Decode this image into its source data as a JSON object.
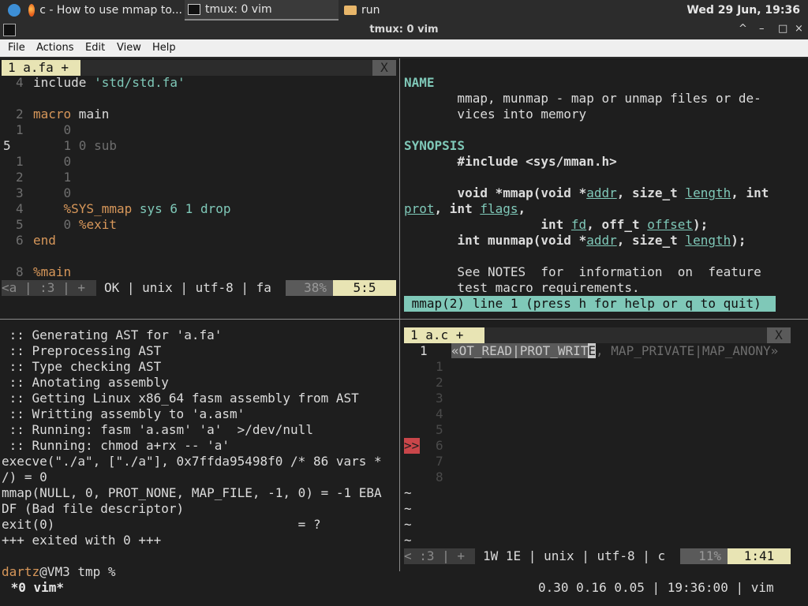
{
  "taskbar": {
    "tabs": [
      {
        "label": "c - How to use mmap to..."
      },
      {
        "label": "tmux: 0 vim"
      },
      {
        "label": "run"
      }
    ],
    "clock": "Wed 29 Jun, 19:36"
  },
  "window": {
    "title": "tmux: 0 vim",
    "controls": [
      "^",
      "–",
      "□",
      "×"
    ]
  },
  "menu": [
    "File",
    "Actions",
    "Edit",
    "View",
    "Help"
  ],
  "left_top": {
    "tab": "1 a.fa +",
    "close": "X",
    "lines": [
      {
        "num": "4",
        "text": "include 'std/std.fa'"
      },
      {
        "num": "",
        "text": ""
      },
      {
        "num": "2",
        "text": "macro main"
      },
      {
        "num": "1",
        "text": "    0"
      },
      {
        "num": "5",
        "text": "    1 0 sub"
      },
      {
        "num": "1",
        "text": "    0"
      },
      {
        "num": "2",
        "text": "    1"
      },
      {
        "num": "3",
        "text": "    0"
      },
      {
        "num": "4",
        "text": "    %SYS_mmap sys 6 1 drop"
      },
      {
        "num": "5",
        "text": "    0 %exit"
      },
      {
        "num": "6",
        "text": "end"
      },
      {
        "num": "",
        "text": ""
      },
      {
        "num": "8",
        "text": "%main"
      }
    ],
    "status": {
      "mode": "<a | :3 | +",
      "info": "OK | unix | utf-8 | fa",
      "percent": "38%",
      "pos": "5:5"
    }
  },
  "right_top": {
    "lines": [
      {
        "text": "NAME"
      },
      {
        "text": "       mmap, munmap - map or unmap files or de-"
      },
      {
        "text": "       vices into memory"
      },
      {
        "text": ""
      },
      {
        "text": "SYNOPSIS"
      },
      {
        "text": "       #include <sys/mman.h>"
      },
      {
        "text": ""
      },
      {
        "text": "       void *mmap(void *addr, size_t length, int"
      },
      {
        "text": "prot, int flags,"
      },
      {
        "text": "                  int fd, off_t offset);"
      },
      {
        "text": "       int munmap(void *addr, size_t length);"
      },
      {
        "text": ""
      },
      {
        "text": "       See NOTES  for  information  on  feature"
      },
      {
        "text": "       test macro requirements."
      }
    ],
    "status": " mmap(2) line 1 (press h for help or q to quit)"
  },
  "left_bottom": {
    "lines": [
      " :: Generating AST for 'a.fa'",
      " :: Preprocessing AST",
      " :: Type checking AST",
      " :: Anotating assembly",
      " :: Getting Linux x86_64 fasm assembly from AST",
      " :: Writting assembly to 'a.asm'",
      " :: Running: fasm 'a.asm' 'a'  >/dev/null",
      " :: Running: chmod a+rx -- 'a'",
      "execve(\"./a\", [\"./a\"], 0x7ffda95498f0 /* 86 vars *",
      "/) = 0",
      "mmap(NULL, 0, PROT_NONE, MAP_FILE, -1, 0) = -1 EBA",
      "DF (Bad file descriptor)",
      "exit(0)                                = ?",
      "+++ exited with 0 +++",
      ""
    ],
    "prompt_user": "dartz",
    "prompt_rest": "@VM3 tmp %"
  },
  "right_bottom": {
    "tab": "1 a.c +",
    "close": "X",
    "first_num": "1",
    "first_line_sel": "«OT_READ|PROT_WRIT",
    "first_line_cur": "E",
    "first_line_rest": ", MAP_PRIVATE|MAP_ANONY»",
    "nums": [
      "1",
      "2",
      "3",
      "4",
      "5",
      "6",
      "7",
      "8"
    ],
    "sign": ">>",
    "tildes": [
      "~",
      "~",
      "~",
      "~"
    ],
    "status": {
      "mode": "< :3 | +",
      "info": "1W 1E | unix | utf-8 | c",
      "percent": "11%",
      "pos": "1:41"
    }
  },
  "tmux": {
    "window": " *0 vim*",
    "right": "0.30 0.16 0.05 | 19:36:00 | vim"
  }
}
